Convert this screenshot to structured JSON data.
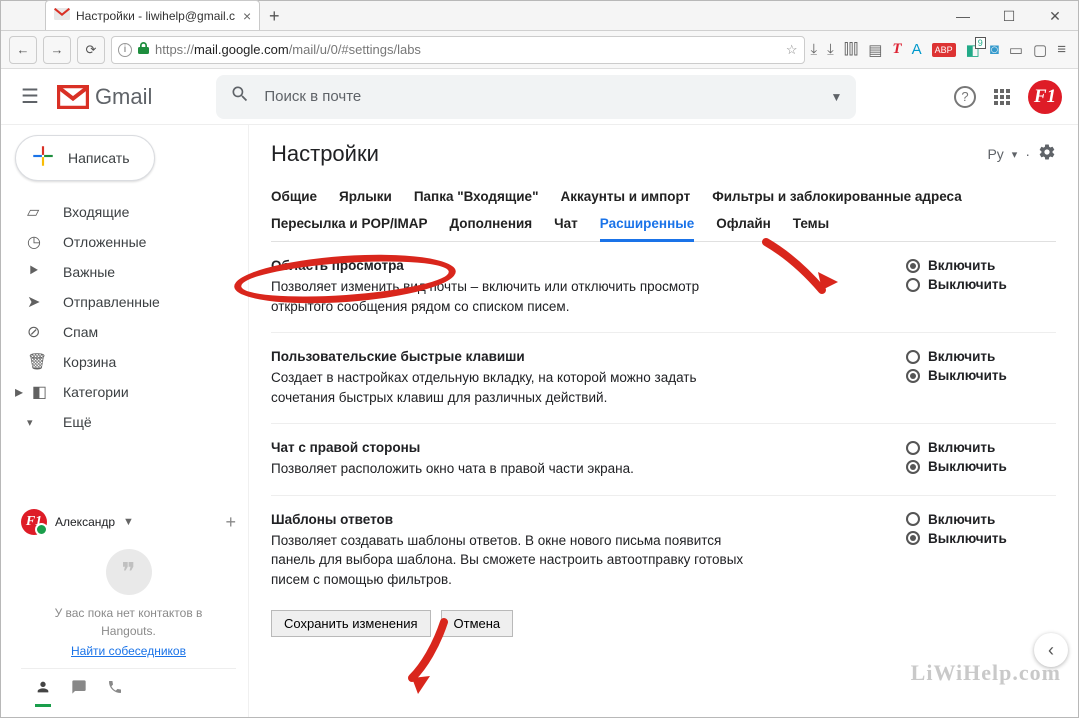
{
  "browser": {
    "tab_title": "Настройки - liwihelp@gmail.c",
    "url_prefix": "https://",
    "url_host": "mail.google.com",
    "url_path": "/mail/u/0/#settings/labs",
    "extension_badge": "9"
  },
  "header": {
    "app_name": "Gmail",
    "search_placeholder": "Поиск в почте"
  },
  "compose_label": "Написать",
  "sidebar": {
    "items": [
      {
        "icon": "inbox",
        "label": "Входящие"
      },
      {
        "icon": "clock",
        "label": "Отложенные"
      },
      {
        "icon": "star",
        "label": "Важные"
      },
      {
        "icon": "send",
        "label": "Отправленные"
      },
      {
        "icon": "spam",
        "label": "Спам"
      },
      {
        "icon": "trash",
        "label": "Корзина"
      },
      {
        "icon": "category",
        "label": "Категории"
      },
      {
        "icon": "more",
        "label": "Ещё"
      }
    ]
  },
  "hangouts": {
    "user": "Александр",
    "empty_msg": "У вас пока нет контактов в Hangouts.",
    "find_link": "Найти собеседников"
  },
  "settings": {
    "title": "Настройки",
    "lang_label": "Ру",
    "tabs1": [
      "Общие",
      "Ярлыки",
      "Папка \"Входящие\"",
      "Аккаунты и импорт",
      "Фильтры и заблокированные адреса"
    ],
    "tabs2": [
      "Пересылка и POP/IMAP",
      "Дополнения",
      "Чат",
      "Расширенные",
      "Офлайн",
      "Темы"
    ],
    "tabs2_active_index": 3,
    "option_on": "Включить",
    "option_off": "Выключить",
    "sections": [
      {
        "title": "Область просмотра",
        "desc": "Позволяет изменить вид почты – включить или отключить просмотр открытого сообщения рядом со списком писем.",
        "checked": "on"
      },
      {
        "title": "Пользовательские быстрые клавиши",
        "desc": "Создает в настройках отдельную вкладку, на которой можно задать сочетания быстрых клавиш для различных действий.",
        "checked": "off"
      },
      {
        "title": "Чат с правой стороны",
        "desc": "Позволяет расположить окно чата в правой части экрана.",
        "checked": "off"
      },
      {
        "title": "Шаблоны ответов",
        "desc": "Позволяет создавать шаблоны ответов. В окне нового письма появится панель для выбора шаблона. Вы сможете настроить автоотправку готовых писем с помощью фильтров.",
        "checked": "off"
      }
    ],
    "save_label": "Сохранить изменения",
    "cancel_label": "Отмена"
  },
  "watermark": "LiWiHelp.com"
}
